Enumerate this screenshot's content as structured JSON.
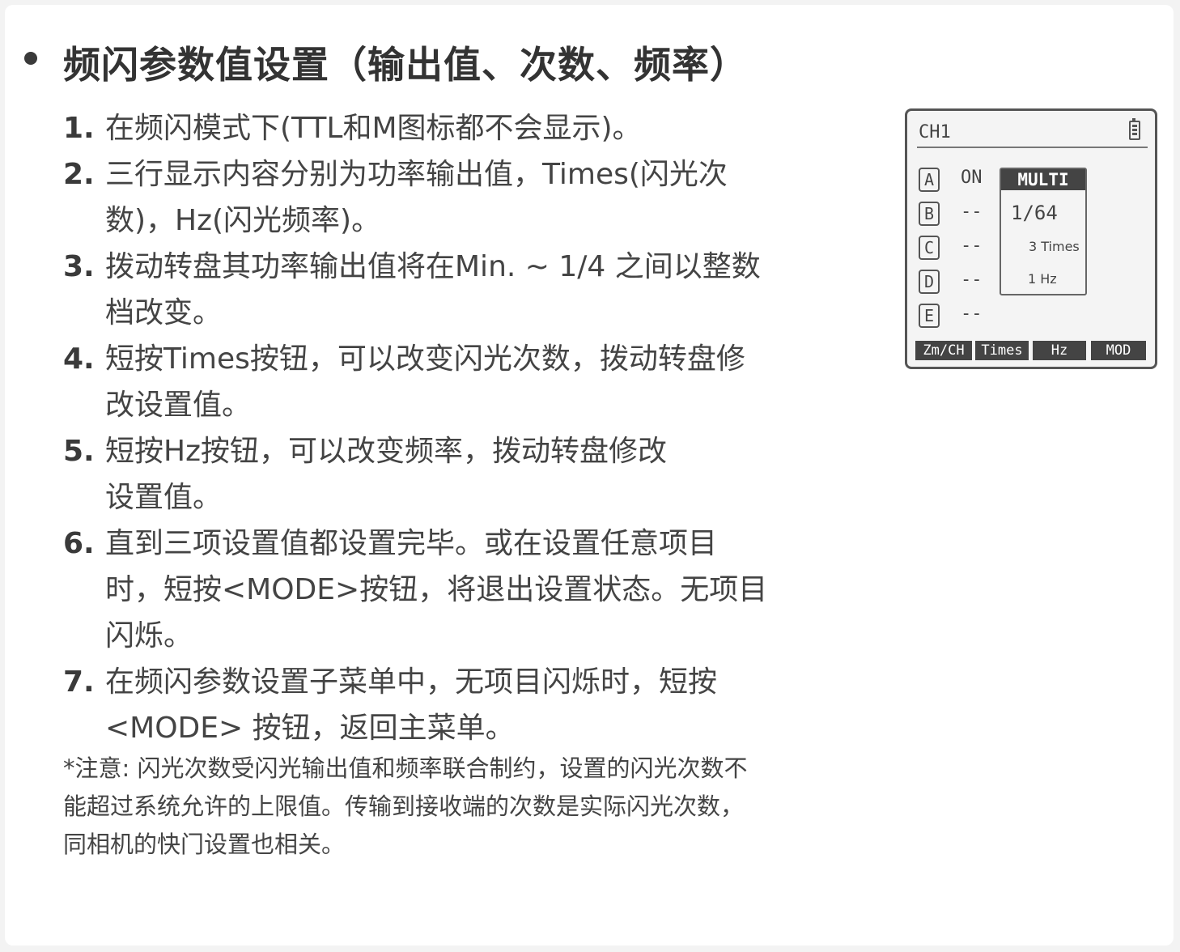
{
  "heading": "频闪参数值设置（输出值、次数、频率）",
  "steps": [
    {
      "num": "1.",
      "lines": [
        "在频闪模式下(TTL和M图标都不会显示)。"
      ]
    },
    {
      "num": "2.",
      "lines": [
        "三行显示内容分别为功率输出值，Times(闪光次",
        "数)，Hz(闪光频率)。"
      ]
    },
    {
      "num": "3.",
      "lines": [
        "拨动转盘其功率输出值将在Min. ~ 1/4 之间以整数",
        "档改变。"
      ]
    },
    {
      "num": "4.",
      "lines": [
        "短按Times按钮，可以改变闪光次数，拨动转盘修",
        "改设置值。"
      ]
    },
    {
      "num": "5.",
      "lines": [
        "短按Hz按钮，可以改变频率，拨动转盘修改",
        "设置值。"
      ]
    },
    {
      "num": "6.",
      "lines": [
        "直到三项设置值都设置完毕。或在设置任意项目",
        "时，短按<MODE>按钮，将退出设置状态。无项目",
        "闪烁。"
      ]
    },
    {
      "num": "7.",
      "lines": [
        "在频闪参数设置子菜单中，无项目闪烁时，短按",
        "<MODE> 按钮，返回主菜单。"
      ]
    }
  ],
  "note": [
    "*注意: 闪光次数受闪光输出值和频率联合制约，设置的闪光次数不",
    "能超过系统允许的上限值。传输到接收端的次数是实际闪光次数，",
    "同相机的快门设置也相关。"
  ],
  "lcd": {
    "channel": "CH1",
    "battery_icon": "battery-icon",
    "groups": [
      {
        "label": "A",
        "value": "ON"
      },
      {
        "label": "B",
        "value": "--"
      },
      {
        "label": "C",
        "value": "--"
      },
      {
        "label": "D",
        "value": "--"
      },
      {
        "label": "E",
        "value": "--"
      }
    ],
    "mode": "MULTI",
    "power": "1/64",
    "times": "3 Times",
    "hz": "1 Hz",
    "softkeys": [
      "Zm/CH",
      "Times",
      "Hz",
      "MOD"
    ]
  }
}
